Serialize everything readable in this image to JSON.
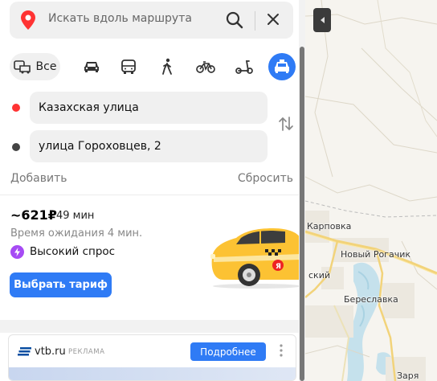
{
  "search": {
    "placeholder": "Искать вдоль маршрута",
    "pin_icon": "location-pin-icon",
    "search_icon": "magnifier-icon",
    "close_icon": "close-icon"
  },
  "modes": {
    "all_label": "Все",
    "selected": "taxi",
    "items": [
      "all",
      "car",
      "bus",
      "walk",
      "bike",
      "scooter",
      "taxi"
    ]
  },
  "route": {
    "from": "Казахская улица",
    "to": "улица Гороховцев, 2",
    "add_label": "Добавить",
    "reset_label": "Сбросить"
  },
  "taxi": {
    "price": "~621₽",
    "duration": "49 мин",
    "wait": "Время ожидания 4 мин.",
    "demand": "Высокий спрос",
    "button": "Выбрать тариф"
  },
  "ad": {
    "domain": "vtb.ru",
    "badge": "РЕКЛАМА",
    "button": "Подробнее"
  },
  "map": {
    "labels": {
      "karpovka": "Карповка",
      "rogachik": "Новый Рогачик",
      "skiy": "ский",
      "bereslavka": "Береславка",
      "zarya": "Заря"
    }
  },
  "colors": {
    "accent": "#2f7bf5",
    "from_dot": "#ff3333",
    "to_dot": "#444444",
    "bolt": "#a64bf4",
    "taxi_yellow": "#fcc233"
  }
}
